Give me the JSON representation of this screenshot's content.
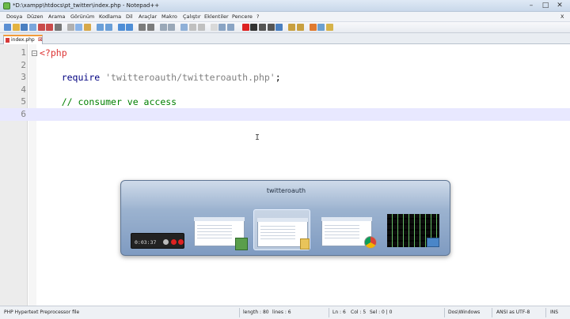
{
  "window": {
    "title": "*D:\\xampp\\htdocs\\pt_twitter\\index.php - Notepad++",
    "controls": {
      "minimize": "–",
      "maximize": "□",
      "close": "✕"
    }
  },
  "menu": {
    "items": [
      "Dosya",
      "Düzen",
      "Arama",
      "Görünüm",
      "Kodlama",
      "Dil",
      "Araçlar",
      "Makro",
      "Çalıştır",
      "Eklentiler",
      "Pencere",
      "?"
    ],
    "close_doc": "X"
  },
  "toolbar": {
    "icons": [
      "new-file-icon",
      "open-icon",
      "save-icon",
      "save-all-icon",
      "close-icon",
      "close-all-icon",
      "print-icon",
      "cut-icon",
      "copy-icon",
      "paste-icon",
      "undo-icon",
      "redo-icon",
      "find-icon",
      "replace-icon",
      "zoom-in-icon",
      "zoom-out-icon",
      "sync-v-icon",
      "sync-h-icon",
      "word-wrap-icon",
      "all-chars-icon",
      "indent-guide-icon",
      "user-lang-icon",
      "doc-map-icon",
      "function-list-icon",
      "record-icon",
      "stop-icon",
      "play-icon",
      "play-multi-icon",
      "save-macro-icon",
      "spell-check-icon",
      "spell-next-icon",
      "bookmark-icon",
      "plugin-icon",
      "highlight-icon"
    ]
  },
  "tab": {
    "label": "index.php",
    "close": "⊠"
  },
  "editor": {
    "lines": [
      {
        "n": "1",
        "tag": "<?php",
        "indent": "",
        "kw": "",
        "str": "",
        "rest": "",
        "comment": ""
      },
      {
        "n": "2",
        "tag": "",
        "indent": "",
        "kw": "",
        "str": "",
        "rest": "",
        "comment": ""
      },
      {
        "n": "3",
        "tag": "",
        "indent": "    ",
        "kw": "require",
        "str": " 'twitteroauth/twitteroauth.php'",
        "rest": ";",
        "comment": ""
      },
      {
        "n": "4",
        "tag": "",
        "indent": "",
        "kw": "",
        "str": "",
        "rest": "",
        "comment": ""
      },
      {
        "n": "5",
        "tag": "",
        "indent": "    ",
        "kw": "",
        "str": "",
        "rest": "",
        "comment": "// consumer ve access"
      },
      {
        "n": "6",
        "tag": "",
        "indent": "",
        "kw": "",
        "str": "",
        "rest": "",
        "comment": ""
      }
    ],
    "current_line": "6",
    "caret": "I",
    "fold_marker": "−"
  },
  "switcher": {
    "title": "twitteroauth",
    "recorder_time": "0:03:37",
    "windows": [
      "screen-recorder",
      "file-explorer-window",
      "twitteroauth-folder",
      "chrome-window",
      "desktop"
    ]
  },
  "status": {
    "lang": "PHP Hypertext Preprocessor file",
    "length": "length : 80",
    "lines": "lines : 6",
    "ln": "Ln : 6",
    "col": "Col : 5",
    "sel": "Sel : 0 | 0",
    "eol": "Dos\\Windows",
    "encoding": "ANSI as UTF-8",
    "mode": "INS"
  },
  "colors": {
    "php_tag": "#dd3333",
    "keyword": "#000080",
    "string": "#808080",
    "comment": "#008000",
    "current_line_bg": "#e8e8ff",
    "switcher_bg": "#9bb2cf"
  }
}
